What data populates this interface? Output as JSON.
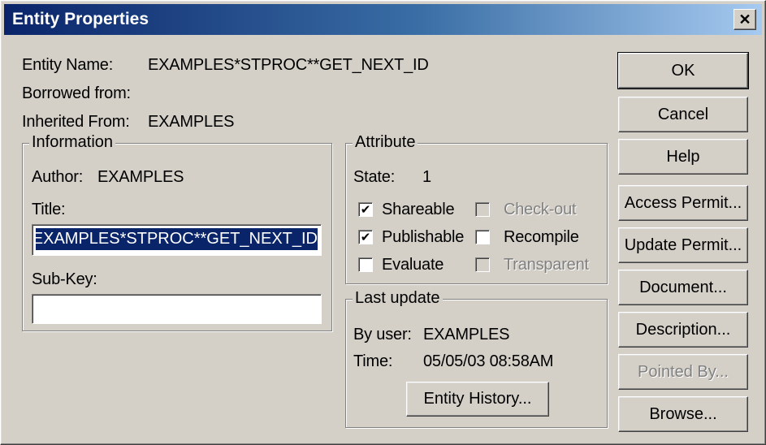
{
  "window": {
    "title": "Entity Properties",
    "close_glyph": "✕",
    "close_icon": "close-icon"
  },
  "entity": {
    "name_label": "Entity Name:",
    "name_value": "EXAMPLES*STPROC**GET_NEXT_ID",
    "borrowed_label": "Borrowed from:",
    "borrowed_value": "",
    "inherited_label": "Inherited From:",
    "inherited_value": "EXAMPLES"
  },
  "information": {
    "legend": "Information",
    "author_label": "Author:",
    "author_value": "EXAMPLES",
    "title_label": "Title:",
    "title_value": "EXAMPLES*STPROC**GET_NEXT_ID",
    "subkey_label": "Sub-Key:",
    "subkey_value": ""
  },
  "attribute": {
    "legend": "Attribute",
    "state_label": "State:",
    "state_value": "1",
    "check_glyph": "✔",
    "checkboxes": [
      {
        "label": "Shareable",
        "checked": true,
        "enabled": true
      },
      {
        "label": "Check-out",
        "checked": false,
        "enabled": false
      },
      {
        "label": "Publishable",
        "checked": true,
        "enabled": true
      },
      {
        "label": "Recompile",
        "checked": false,
        "enabled": true
      },
      {
        "label": "Evaluate",
        "checked": false,
        "enabled": true
      },
      {
        "label": "Transparent",
        "checked": false,
        "enabled": false
      }
    ]
  },
  "last_update": {
    "legend": "Last update",
    "user_label": "By user:",
    "user_value": "EXAMPLES",
    "time_label": "Time:",
    "time_value": "05/05/03 08:58AM",
    "history_button": "Entity History..."
  },
  "buttons": {
    "ok": "OK",
    "cancel": "Cancel",
    "help": "Help",
    "access_permit": "Access Permit...",
    "update_permit": "Update Permit...",
    "document": "Document...",
    "description": "Description...",
    "pointed_by": "Pointed By...",
    "browse": "Browse..."
  },
  "colors": {
    "face": "#d4d0c8",
    "title_gradient_start": "#0a246a",
    "title_gradient_end": "#a6caf0",
    "selection": "#0a246a",
    "disabled_text": "#808080"
  }
}
